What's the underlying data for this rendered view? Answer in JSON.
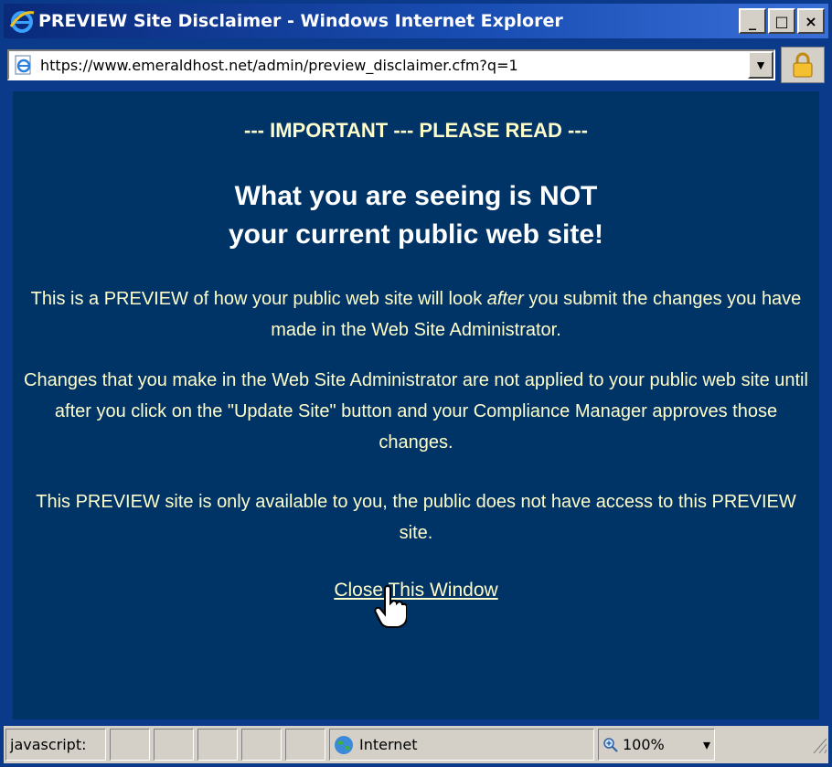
{
  "window": {
    "title": "PREVIEW Site Disclaimer - Windows Internet Explorer",
    "controls": {
      "minimize": "_",
      "maximize": "□",
      "close": "×"
    }
  },
  "address": {
    "url": "https://www.emeraldhost.net/admin/preview_disclaimer.cfm?q=1",
    "icon": "ie-page-icon",
    "dropdown": "▼",
    "security": "lock-icon"
  },
  "content": {
    "important": "--- IMPORTANT --- PLEASE READ ---",
    "headline_line1": "What you are seeing is NOT",
    "headline_line2": "your current public web site!",
    "p1_before": "This is a PREVIEW of how your public web site will look ",
    "p1_em": "after",
    "p1_after": " you submit the changes you have made in the Web Site Administrator.",
    "p2": "Changes that you make in the Web Site Administrator are not applied to your public web site until after you click on the \"Update Site\" button and your Compliance Manager approves those changes.",
    "p3": "This PREVIEW site is only available to you, the public does not have access to this PREVIEW site.",
    "close_link": "Close This Window"
  },
  "status": {
    "text": "javascript:",
    "zone": "Internet",
    "zoom": "100%",
    "zoom_dropdown": "▾"
  },
  "colors": {
    "content_bg": "#003366",
    "text": "#ffffcc",
    "headline": "#ffffff"
  }
}
